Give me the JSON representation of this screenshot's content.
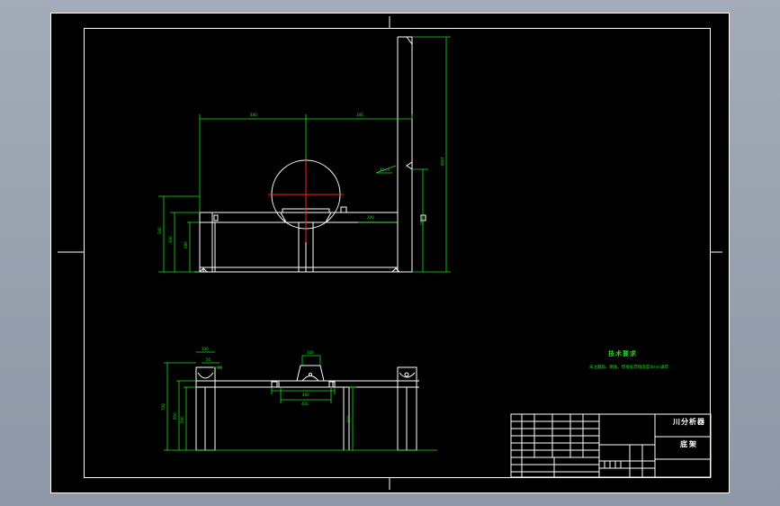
{
  "notes": {
    "title": "技术要求",
    "text": "未注圆角、倒角，焊接处焊缝高度4mm满焊"
  },
  "title_block": {
    "drawing_name": "川分析器",
    "part_name": "底架"
  },
  "colors": {
    "background": "#000000",
    "outline": "#ffffff",
    "dimension": "#18e018",
    "centerline": "#ff2020",
    "window": "#9aa3b0"
  }
}
